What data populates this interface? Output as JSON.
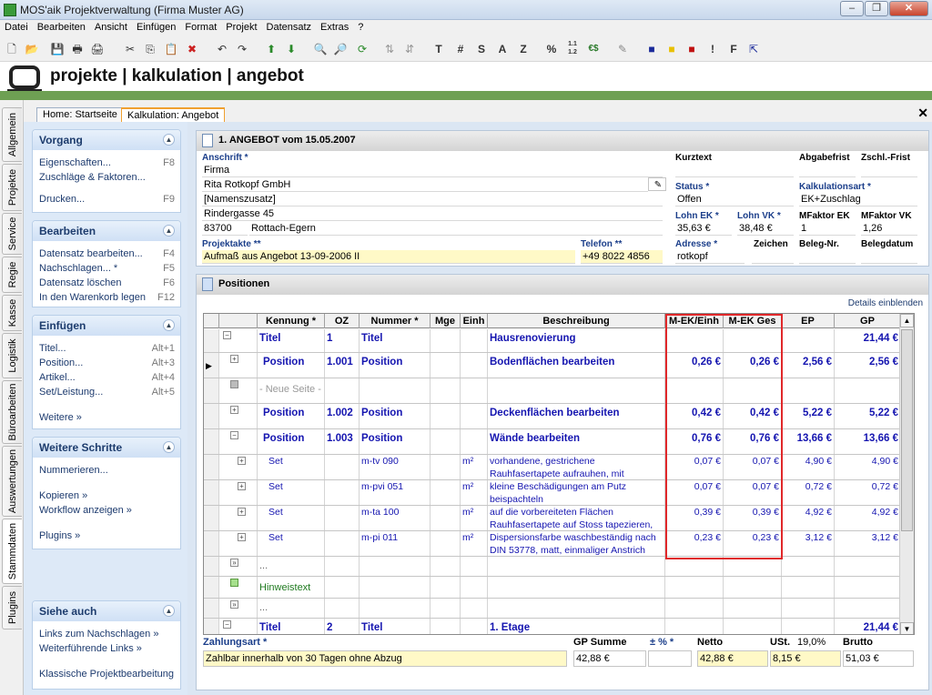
{
  "window": {
    "title": "MOS'aik Projektverwaltung (Firma Muster AG)"
  },
  "menu": [
    "Datei",
    "Bearbeiten",
    "Ansicht",
    "Einfügen",
    "Format",
    "Projekt",
    "Datensatz",
    "Extras",
    "?"
  ],
  "toolbar_letters": [
    "T",
    "#",
    "S",
    "A",
    "Z",
    "%",
    "1.1 1.2",
    "€$",
    "!",
    "F"
  ],
  "banner": {
    "title": "projekte | kalkulation | angebot"
  },
  "vtabs": [
    "Allgemein",
    "Projekte",
    "Service",
    "Regie",
    "Kasse",
    "Logistik",
    "Büroarbeiten",
    "Auswertungen",
    "Stammdaten",
    "Plugins"
  ],
  "tabs": [
    "Home: Startseite",
    "Kalkulation: Angebot"
  ],
  "groups": [
    {
      "title": "Vorgang",
      "items": [
        {
          "label": "Eigenschaften...",
          "key": "F8"
        },
        {
          "label": "Zuschläge & Faktoren...",
          "key": ""
        },
        {
          "label": "",
          "key": ""
        },
        {
          "label": "Drucken...",
          "key": "F9"
        }
      ]
    },
    {
      "title": "Bearbeiten",
      "items": [
        {
          "label": "Datensatz bearbeiten...",
          "key": "F4"
        },
        {
          "label": "Nachschlagen... *",
          "key": "F5"
        },
        {
          "label": "Datensatz löschen",
          "key": "F6"
        },
        {
          "label": "In den Warenkorb legen",
          "key": "F12"
        }
      ]
    },
    {
      "title": "Einfügen",
      "items": [
        {
          "label": "Titel...",
          "key": "Alt+1"
        },
        {
          "label": "Position...",
          "key": "Alt+3"
        },
        {
          "label": "Artikel...",
          "key": "Alt+4"
        },
        {
          "label": "Set/Leistung...",
          "key": "Alt+5"
        },
        {
          "label": "",
          "key": ""
        },
        {
          "label": "Weitere »",
          "key": ""
        }
      ]
    },
    {
      "title": "Weitere Schritte",
      "items": [
        {
          "label": "Nummerieren...",
          "key": ""
        },
        {
          "label": "",
          "key": ""
        },
        {
          "label": "Kopieren »",
          "key": ""
        },
        {
          "label": "Workflow anzeigen »",
          "key": ""
        },
        {
          "label": "",
          "key": ""
        },
        {
          "label": "Plugins »",
          "key": ""
        }
      ]
    },
    {
      "title": "Siehe auch",
      "items": [
        {
          "label": "Links zum Nachschlagen »",
          "key": ""
        },
        {
          "label": "Weiterführende Links »",
          "key": ""
        },
        {
          "label": "",
          "key": ""
        },
        {
          "label": "Klassische Projektbearbeitung",
          "key": ""
        }
      ]
    }
  ],
  "angebot": {
    "header": "1. ANGEBOT vom 15.05.2007",
    "anschrift_label": "Anschrift *",
    "address": [
      "Firma",
      "Rita Rotkopf GmbH",
      "[Namenszusatz]",
      "Rindergasse 45"
    ],
    "plz": "83700",
    "ort": "Rottach-Egern",
    "projektakte_label": "Projektakte **",
    "projektakte": "Aufmaß aus Angebot 13-09-2006 II",
    "telefon_label": "Telefon **",
    "telefon": "+49 8022 4856",
    "kurztext_label": "Kurztext",
    "abgabefrist_label": "Abgabefrist",
    "zschl_label": "Zschl.-Frist",
    "status_label": "Status *",
    "status": "Offen",
    "kalkulationsart_label": "Kalkulationsart *",
    "kalkulationsart": "EK+Zuschlag",
    "lohnek_label": "Lohn EK *",
    "lohnek": "35,63 €",
    "lohnvk_label": "Lohn VK *",
    "lohnvk": "38,48 €",
    "mfaktorek_label": "MFaktor EK",
    "mfaktorek": "1",
    "mfaktorvk_label": "MFaktor VK",
    "mfaktorvk": "1,26",
    "adresse_label": "Adresse *",
    "adresse": "rotkopf",
    "zeichen_label": "Zeichen",
    "belegnr_label": "Beleg-Nr.",
    "belegdatum_label": "Belegdatum"
  },
  "positionen": {
    "title": "Positionen",
    "details_link": "Details einblenden",
    "columns": [
      "Kennung *",
      "OZ",
      "Nummer *",
      "Mge",
      "Einh",
      "Beschreibung",
      "M-EK/Einh",
      "M-EK Ges",
      "EP",
      "GP"
    ],
    "rows": [
      {
        "kennung": "Titel",
        "oz": "1",
        "nummer": "Titel",
        "mge": "",
        "einh": "",
        "beschreibung": "Hausrenovierung",
        "mekeinh": "",
        "mekges": "",
        "ep": "",
        "gp": "21,44 €",
        "style": "title",
        "tree": "minus"
      },
      {
        "kennung": "Position",
        "oz": "1.001",
        "nummer": "Position",
        "mge": "",
        "einh": "",
        "beschreibung": "Bodenflächen bearbeiten",
        "mekeinh": "0,26 €",
        "mekges": "0,26 €",
        "ep": "2,56 €",
        "gp": "2,56 €",
        "style": "position",
        "tree": "plus",
        "current": true
      },
      {
        "kennung": "- Neue Seite -",
        "oz": "",
        "nummer": "",
        "mge": "",
        "einh": "",
        "beschreibung": "",
        "mekeinh": "",
        "mekges": "",
        "ep": "",
        "gp": "",
        "style": "page",
        "tree": "box"
      },
      {
        "kennung": "Position",
        "oz": "1.002",
        "nummer": "Position",
        "mge": "",
        "einh": "",
        "beschreibung": "Deckenflächen bearbeiten",
        "mekeinh": "0,42 €",
        "mekges": "0,42 €",
        "ep": "5,22 €",
        "gp": "5,22 €",
        "style": "position",
        "tree": "plus"
      },
      {
        "kennung": "Position",
        "oz": "1.003",
        "nummer": "Position",
        "mge": "",
        "einh": "",
        "beschreibung": "Wände bearbeiten",
        "mekeinh": "0,76 €",
        "mekges": "0,76 €",
        "ep": "13,66 €",
        "gp": "13,66 €",
        "style": "position",
        "tree": "minus"
      },
      {
        "kennung": "Set",
        "oz": "",
        "nummer": "m-tv 090",
        "mge": "",
        "einh": "m²",
        "beschreibung": "vorhandene, gestrichene Rauhfasertapete aufrauhen, mit",
        "mekeinh": "0,07 €",
        "mekges": "0,07 €",
        "ep": "4,90 €",
        "gp": "4,90 €",
        "style": "set",
        "tree": "plus"
      },
      {
        "kennung": "Set",
        "oz": "",
        "nummer": "m-pvi 051",
        "mge": "",
        "einh": "m²",
        "beschreibung": "kleine Beschädigungen am Putz beispachteln",
        "mekeinh": "0,07 €",
        "mekges": "0,07 €",
        "ep": "0,72 €",
        "gp": "0,72 €",
        "style": "set",
        "tree": "plus"
      },
      {
        "kennung": "Set",
        "oz": "",
        "nummer": "m-ta 100",
        "mge": "",
        "einh": "m²",
        "beschreibung": "auf die vorbereiteten Flächen Rauhfasertapete auf Stoss tapezieren,",
        "mekeinh": "0,39 €",
        "mekges": "0,39 €",
        "ep": "4,92 €",
        "gp": "4,92 €",
        "style": "set",
        "tree": "plus"
      },
      {
        "kennung": "Set",
        "oz": "",
        "nummer": "m-pi 011",
        "mge": "",
        "einh": "m²",
        "beschreibung": "Dispersionsfarbe waschbeständig nach DIN 53778, matt, einmaliger Anstrich",
        "mekeinh": "0,23 €",
        "mekges": "0,23 €",
        "ep": "3,12 €",
        "gp": "3,12 €",
        "style": "set",
        "tree": "plus"
      },
      {
        "kennung": "...",
        "oz": "",
        "nummer": "",
        "mge": "",
        "einh": "",
        "beschreibung": "",
        "mekeinh": "",
        "mekges": "",
        "ep": "",
        "gp": "",
        "style": "dots",
        "tree": "arrow"
      },
      {
        "kennung": "Hinweistext",
        "oz": "",
        "nummer": "",
        "mge": "",
        "einh": "",
        "beschreibung": "",
        "mekeinh": "",
        "mekges": "",
        "ep": "",
        "gp": "",
        "style": "hint",
        "tree": "green"
      },
      {
        "kennung": "...",
        "oz": "",
        "nummer": "",
        "mge": "",
        "einh": "",
        "beschreibung": "",
        "mekeinh": "",
        "mekges": "",
        "ep": "",
        "gp": "",
        "style": "dots",
        "tree": "arrow"
      },
      {
        "kennung": "Titel",
        "oz": "2",
        "nummer": "Titel",
        "mge": "",
        "einh": "",
        "beschreibung": "1. Etage",
        "mekeinh": "",
        "mekges": "",
        "ep": "",
        "gp": "21,44 €",
        "style": "title",
        "tree": "minus"
      }
    ]
  },
  "footer": {
    "zahlungsart_label": "Zahlungsart *",
    "zahlungsart": "Zahlbar innerhalb von 30 Tagen ohne Abzug",
    "gpsumme_label": "GP Summe",
    "gpsumme": "42,88 €",
    "prozent_label": "± % *",
    "prozent": "",
    "netto_label": "Netto",
    "netto": "42,88 €",
    "ust_label": "USt.",
    "ust_rate": "19,0%",
    "ust": "8,15 €",
    "brutto_label": "Brutto",
    "brutto": "51,03 €"
  },
  "colors": {
    "accent_green": "#6ea053",
    "highlight_red": "#e0282a",
    "link_blue": "#1c3a6e",
    "item_blue": "#1515b0"
  }
}
